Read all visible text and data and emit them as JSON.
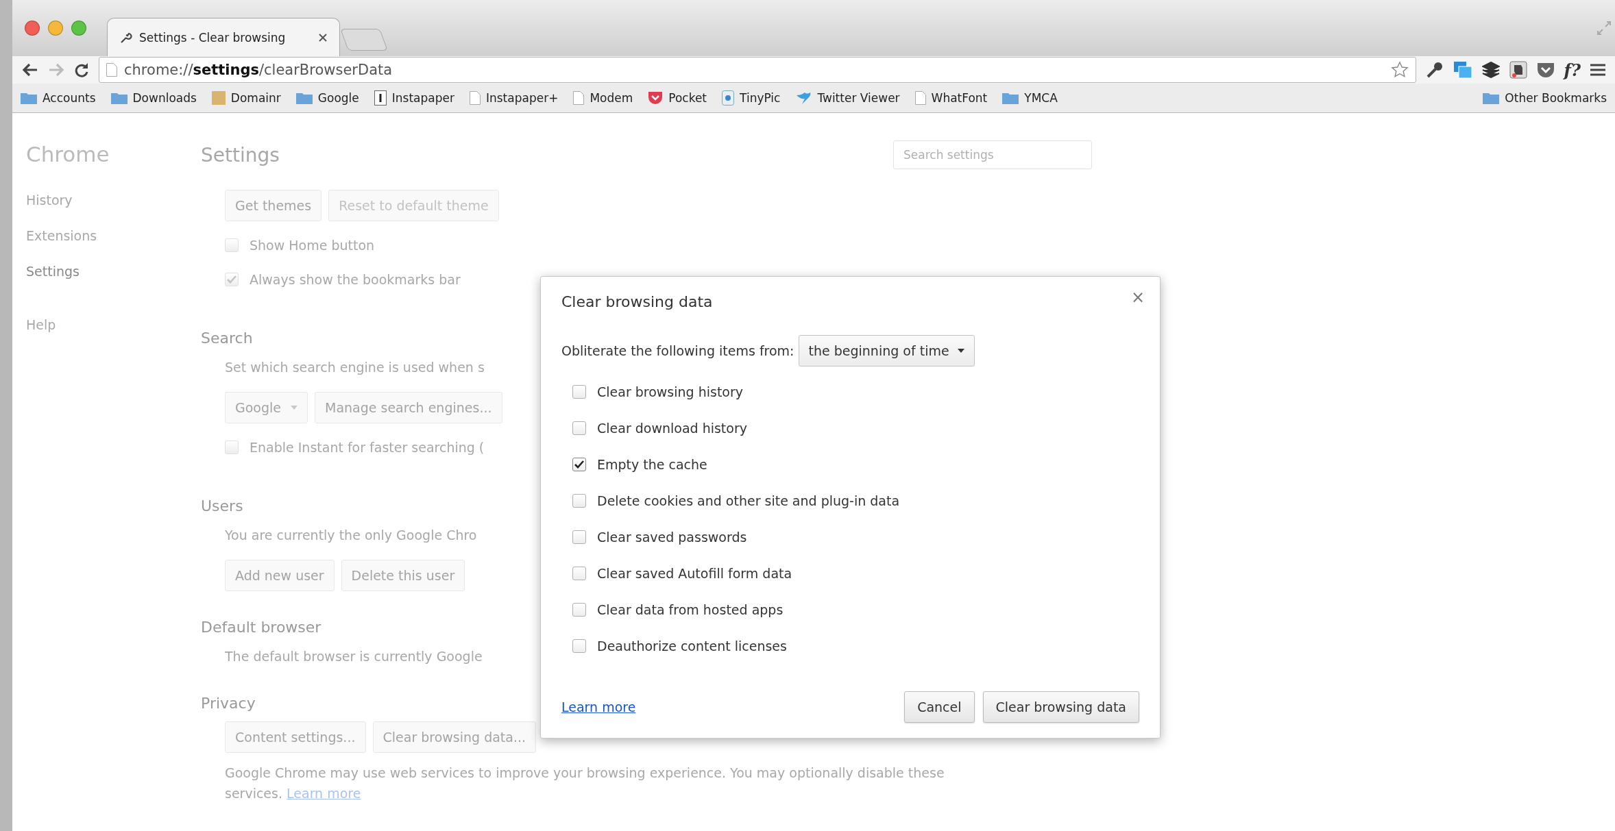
{
  "window": {
    "tab_title": "Settings - Clear browsing",
    "url": "chrome://**settings**/clearBrowserData",
    "whatfont_label": "f?"
  },
  "bookmarks": [
    {
      "kind": "folder",
      "label": "Accounts"
    },
    {
      "kind": "folder",
      "label": "Downloads"
    },
    {
      "kind": "tan",
      "label": "Domainr"
    },
    {
      "kind": "folder",
      "label": "Google"
    },
    {
      "kind": "letterbox",
      "label": "Instapaper"
    },
    {
      "kind": "page",
      "label": "Instapaper+"
    },
    {
      "kind": "page",
      "label": "Modem"
    },
    {
      "kind": "pocket",
      "label": "Pocket"
    },
    {
      "kind": "tinypic",
      "label": "TinyPic"
    },
    {
      "kind": "bird",
      "label": "Twitter Viewer"
    },
    {
      "kind": "page",
      "label": "WhatFont"
    },
    {
      "kind": "folder",
      "label": "YMCA"
    }
  ],
  "other_bookmarks": "Other Bookmarks",
  "sidebar": {
    "title": "Chrome",
    "groups": [
      {
        "items": [
          {
            "label": "History",
            "selected": false
          },
          {
            "label": "Extensions",
            "selected": false
          },
          {
            "label": "Settings",
            "selected": true
          }
        ]
      },
      {
        "items": [
          {
            "label": "Help",
            "selected": false
          }
        ]
      }
    ]
  },
  "settings": {
    "title": "Settings",
    "search": {
      "placeholder": "Search settings"
    },
    "sections": [
      {
        "rows": [
          {
            "kind": "buttons",
            "items": [
              {
                "kind": "button",
                "label": "Get themes"
              },
              {
                "kind": "button",
                "label": "Reset to default theme",
                "disabled": true
              }
            ]
          },
          {
            "kind": "checkbox",
            "label": "Show Home button",
            "checked": false
          },
          {
            "kind": "checkbox",
            "label": "Always show the bookmarks bar",
            "checked": true
          }
        ]
      },
      {
        "heading": "Search",
        "rows": [
          {
            "kind": "text",
            "text": "Set which search engine is used when s"
          },
          {
            "kind": "buttons",
            "items": [
              {
                "kind": "select",
                "label": "Google"
              },
              {
                "kind": "button",
                "label": "Manage search engines..."
              }
            ]
          },
          {
            "kind": "checkbox",
            "label": "Enable Instant for faster searching (",
            "checked": false
          }
        ]
      },
      {
        "heading": "Users",
        "rows": [
          {
            "kind": "text",
            "text": "You are currently the only Google Chro"
          },
          {
            "kind": "buttons",
            "items": [
              {
                "kind": "button",
                "label": "Add new user"
              },
              {
                "kind": "button",
                "label": "Delete this user"
              }
            ]
          }
        ]
      },
      {
        "heading": "Default browser",
        "rows": [
          {
            "kind": "text",
            "text": "The default browser is currently Google"
          }
        ]
      },
      {
        "heading": "Privacy",
        "rows": [
          {
            "kind": "buttons",
            "items": [
              {
                "kind": "button",
                "label": "Content settings..."
              },
              {
                "kind": "button",
                "label": "Clear browsing data..."
              }
            ]
          },
          {
            "kind": "text",
            "text": "Google Chrome may use web services to improve your browsing experience. You may optionally disable these services.",
            "link": "Learn more"
          }
        ]
      }
    ]
  },
  "dialog": {
    "title": "Clear browsing data",
    "close": "×",
    "period_label": "Obliterate the following items from:",
    "period": "the beginning of time",
    "items": [
      {
        "label": "Clear browsing history",
        "checked": false
      },
      {
        "label": "Clear download history",
        "checked": false
      },
      {
        "label": "Empty the cache",
        "checked": true
      },
      {
        "label": "Delete cookies and other site and plug-in data",
        "checked": false
      },
      {
        "label": "Clear saved passwords",
        "checked": false
      },
      {
        "label": "Clear saved Autofill form data",
        "checked": false
      },
      {
        "label": "Clear data from hosted apps",
        "checked": false
      },
      {
        "label": "Deauthorize content licenses",
        "checked": false
      }
    ],
    "learn_more": "Learn more",
    "buttons": [
      "Cancel",
      "Clear browsing data"
    ]
  }
}
